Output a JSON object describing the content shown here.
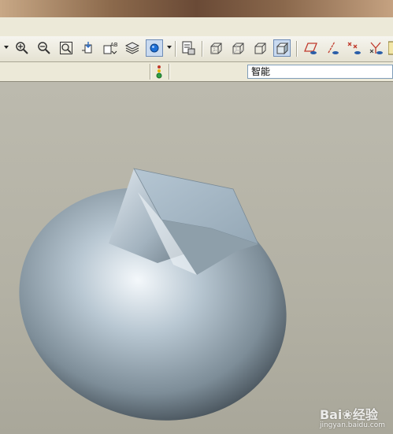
{
  "toolbar": {
    "buttons": [
      {
        "icon": "zoom-in-icon"
      },
      {
        "icon": "zoom-out-icon"
      },
      {
        "icon": "refit-icon"
      },
      {
        "icon": "reorient-icon"
      },
      {
        "icon": "saved-views-icon"
      },
      {
        "icon": "layers-icon"
      },
      {
        "icon": "display-style-icon",
        "active": true
      },
      {
        "icon": "view-manager-icon"
      },
      {
        "icon": "wireframe-icon"
      },
      {
        "icon": "hidden-line-icon"
      },
      {
        "icon": "no-hidden-icon"
      },
      {
        "icon": "shading-icon",
        "active": true
      },
      {
        "icon": "datum-planes-icon"
      },
      {
        "icon": "datum-axes-icon"
      },
      {
        "icon": "datum-points-icon"
      },
      {
        "icon": "coordinate-systems-icon"
      }
    ]
  },
  "status_bar": {
    "selection_filter": "智能"
  },
  "watermark": {
    "brand": "Bai",
    "suffix": "经验",
    "url": "jingyan.baidu.com"
  },
  "colors": {
    "viewport_bg": "#b5b2a5",
    "model_surface": "#a9bac6",
    "toolbar_bg": "#ece9d8",
    "active_button": "#c9daf0"
  }
}
